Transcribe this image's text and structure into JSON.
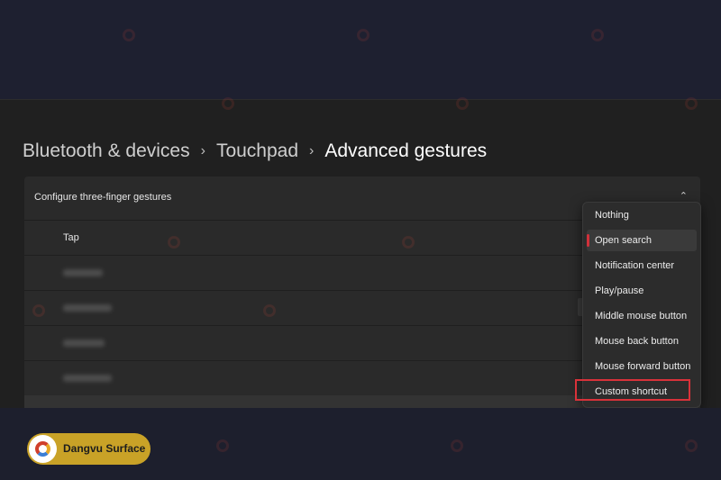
{
  "breadcrumb": {
    "item1": "Bluetooth & devices",
    "item2": "Touchpad",
    "current": "Advanced gestures",
    "separator": "›"
  },
  "card": {
    "title": "Configure three-finger gestures",
    "rows": [
      {
        "label": "Tap"
      }
    ]
  },
  "dropdown": {
    "options": [
      {
        "label": "Nothing"
      },
      {
        "label": "Open search",
        "selected": true
      },
      {
        "label": "Notification center"
      },
      {
        "label": "Play/pause"
      },
      {
        "label": "Middle mouse button"
      },
      {
        "label": "Mouse back button"
      },
      {
        "label": "Mouse forward button"
      },
      {
        "label": "Custom shortcut",
        "highlighted": true
      }
    ]
  },
  "watermark": {
    "label": "Dangvu Surface"
  },
  "icons": {
    "chevron": "chevron-up-icon",
    "logo": "dangvu-logo-icon"
  },
  "colors": {
    "highlight": "#d8323a",
    "accent": "#d0313a",
    "brand": "#c9a227"
  }
}
